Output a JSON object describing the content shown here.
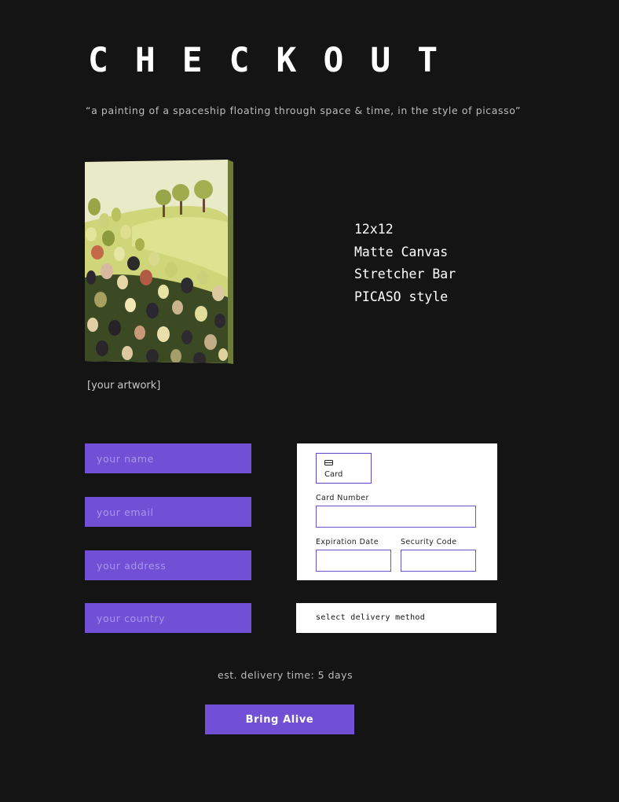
{
  "header": {
    "title": "CHECKOUT",
    "prompt": "“a painting of a spaceship floating through space & time, in the style of picasso”"
  },
  "artwork": {
    "caption": "[your artwork]"
  },
  "specs": {
    "size": "12x12",
    "finish": "Matte Canvas",
    "mount": "Stretcher Bar",
    "style": "PICASO style"
  },
  "form": {
    "name_placeholder": "your name",
    "email_placeholder": "your email",
    "address_placeholder": "your address",
    "country_placeholder": "your country"
  },
  "payment": {
    "tab_label": "Card",
    "card_number_label": "Card Number",
    "expiration_label": "Expiration Date",
    "security_label": "Security Code"
  },
  "delivery": {
    "select_label": "select delivery method",
    "estimate": "est. delivery time: 5 days"
  },
  "submit_label": "Bring Alive",
  "colors": {
    "background": "#141414",
    "accent": "#7150d6"
  }
}
